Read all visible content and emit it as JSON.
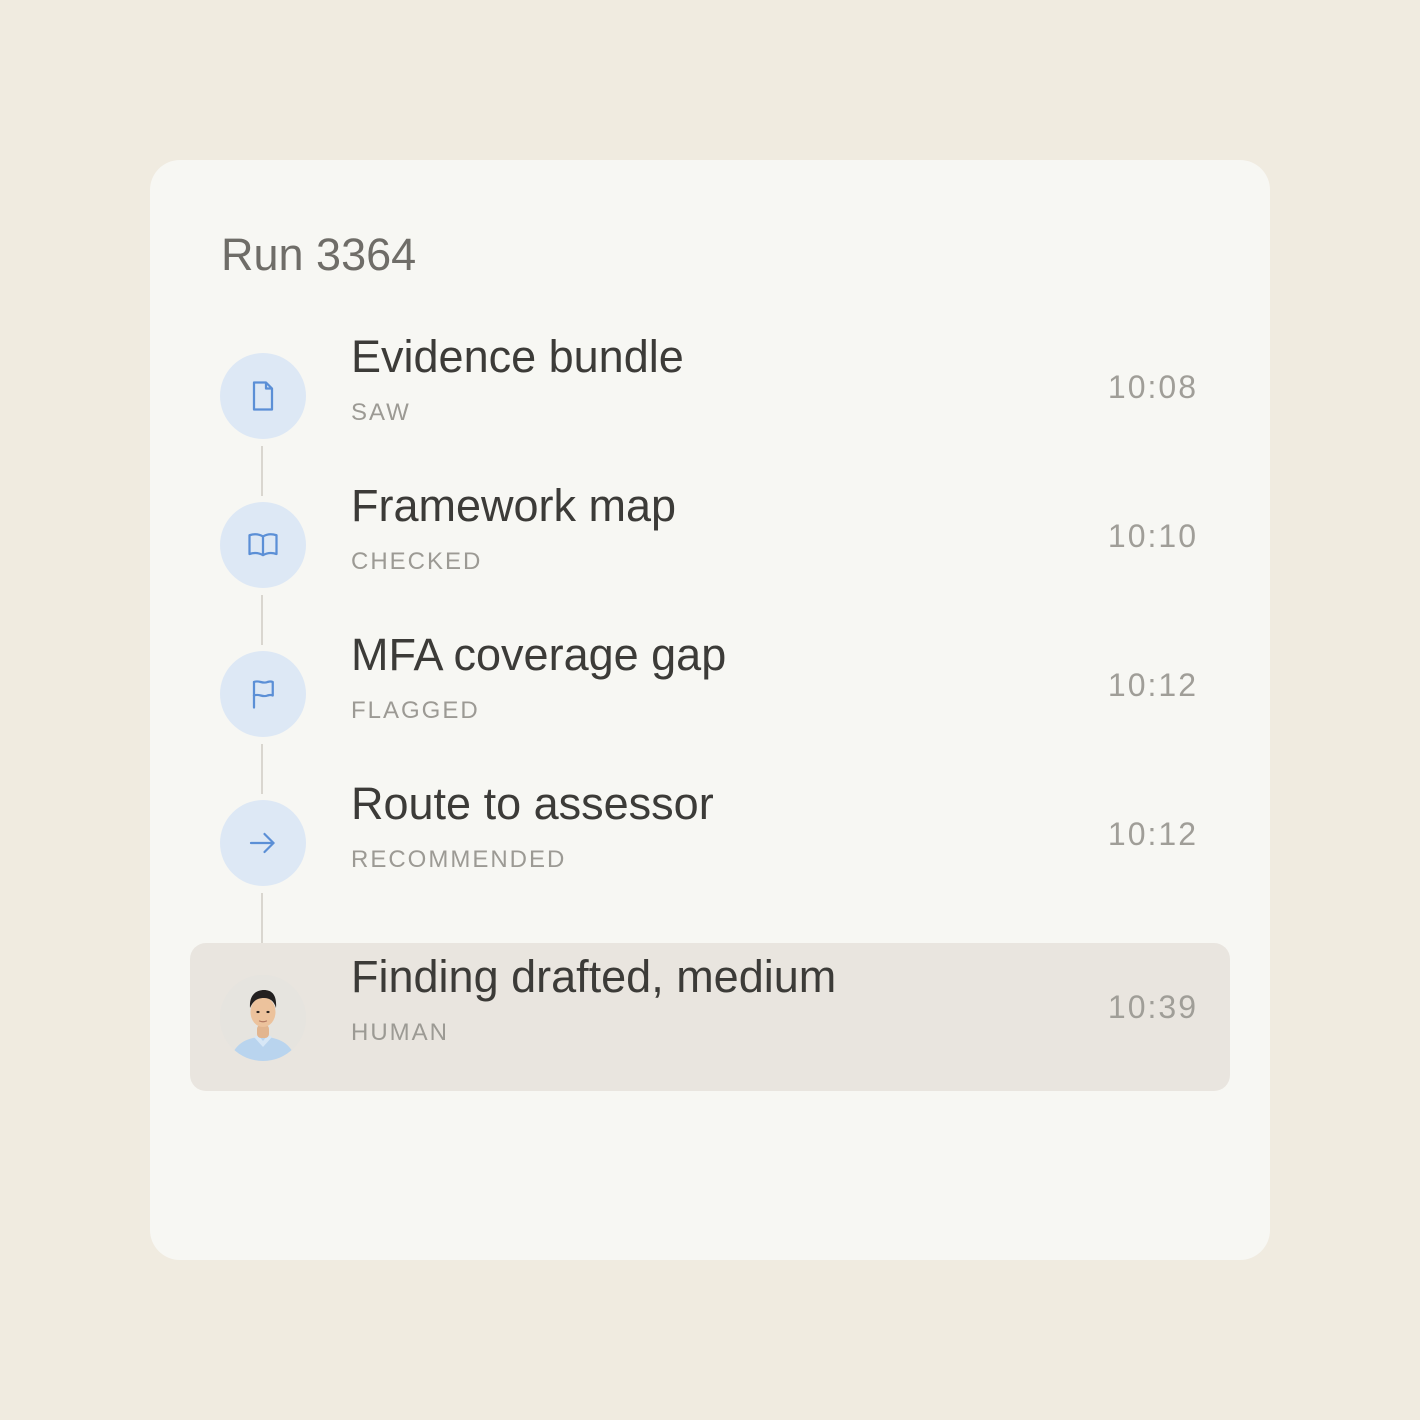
{
  "run": {
    "title": "Run 3364"
  },
  "colors": {
    "background": "#f0ebe0",
    "card": "#f7f7f3",
    "icon_bg": "#dde8f5",
    "icon_stroke": "#5b8fd6",
    "highlight_row": "#e9e5df"
  },
  "timeline": [
    {
      "icon": "document-icon",
      "title": "Evidence bundle",
      "status": "SAW",
      "time": "10:08"
    },
    {
      "icon": "book-icon",
      "title": "Framework map",
      "status": "CHECKED",
      "time": "10:10"
    },
    {
      "icon": "flag-icon",
      "title": "MFA coverage gap",
      "status": "FLAGGED",
      "time": "10:12"
    },
    {
      "icon": "arrow-right-icon",
      "title": "Route to assessor",
      "status": "RECOMMENDED",
      "time": "10:12"
    },
    {
      "icon": "avatar",
      "title": "Finding drafted, medium",
      "status": "HUMAN",
      "time": "10:39",
      "highlighted": true
    }
  ]
}
